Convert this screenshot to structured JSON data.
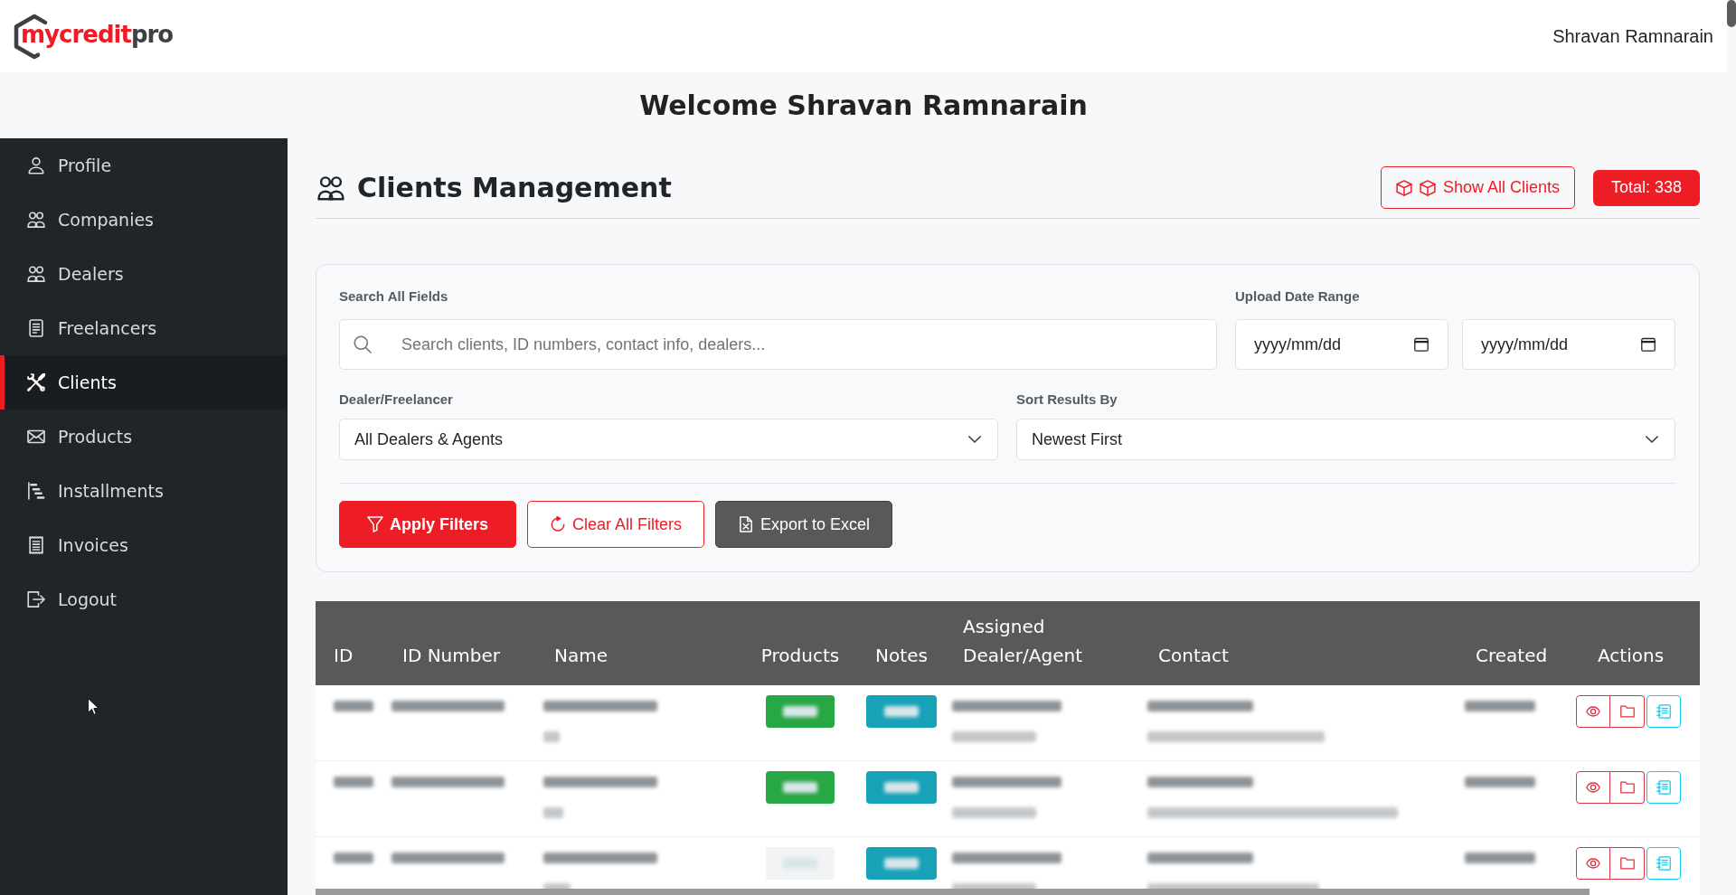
{
  "header": {
    "logo": {
      "primary": "mycredit",
      "secondary": "pro"
    },
    "user_name": "Shravan Ramnarain"
  },
  "welcome": "Welcome Shravan Ramnarain",
  "sidebar": {
    "items": [
      {
        "label": "Profile",
        "selected": false
      },
      {
        "label": "Companies",
        "selected": false
      },
      {
        "label": "Dealers",
        "selected": false
      },
      {
        "label": "Freelancers",
        "selected": false
      },
      {
        "label": "Clients",
        "selected": true
      },
      {
        "label": "Products",
        "selected": false
      },
      {
        "label": "Installments",
        "selected": false
      },
      {
        "label": "Invoices",
        "selected": false
      },
      {
        "label": "Logout",
        "selected": false
      }
    ]
  },
  "page_header": {
    "title": "Clients Management",
    "show_all_button": "Show All Clients",
    "total": "Total: 338"
  },
  "filters": {
    "search": {
      "label": "Search All Fields",
      "placeholder": "Search clients, ID numbers, contact info, dealers..."
    },
    "date_range": {
      "label": "Upload Date Range",
      "fields": [
        {
          "placeholder": "yyyy/mm/dd"
        },
        {
          "placeholder": "yyyy/mm/dd"
        }
      ]
    },
    "selects": [
      {
        "label": "Dealer/Freelancer",
        "value": "All Dealers & Agents"
      },
      {
        "label": "Sort Results By",
        "value": "Newest First"
      }
    ],
    "buttons": [
      {
        "label": "Apply Filters",
        "kind": "filled"
      },
      {
        "label": "Clear All Filters",
        "kind": "outline"
      },
      {
        "label": "Export to Excel",
        "kind": "dark"
      }
    ]
  },
  "table": {
    "columns": [
      "ID",
      "ID Number",
      "Name",
      "Products",
      "Notes",
      "Assigned Dealer/Agent",
      "Contact",
      "Created",
      "Actions"
    ],
    "rows": [
      {
        "products_badge": {
          "color": "#28a745"
        }
      },
      {
        "products_badge": {
          "color": "#28a745"
        }
      },
      {
        "products_badge": {
          "color": "#f1f3f5"
        }
      }
    ]
  }
}
